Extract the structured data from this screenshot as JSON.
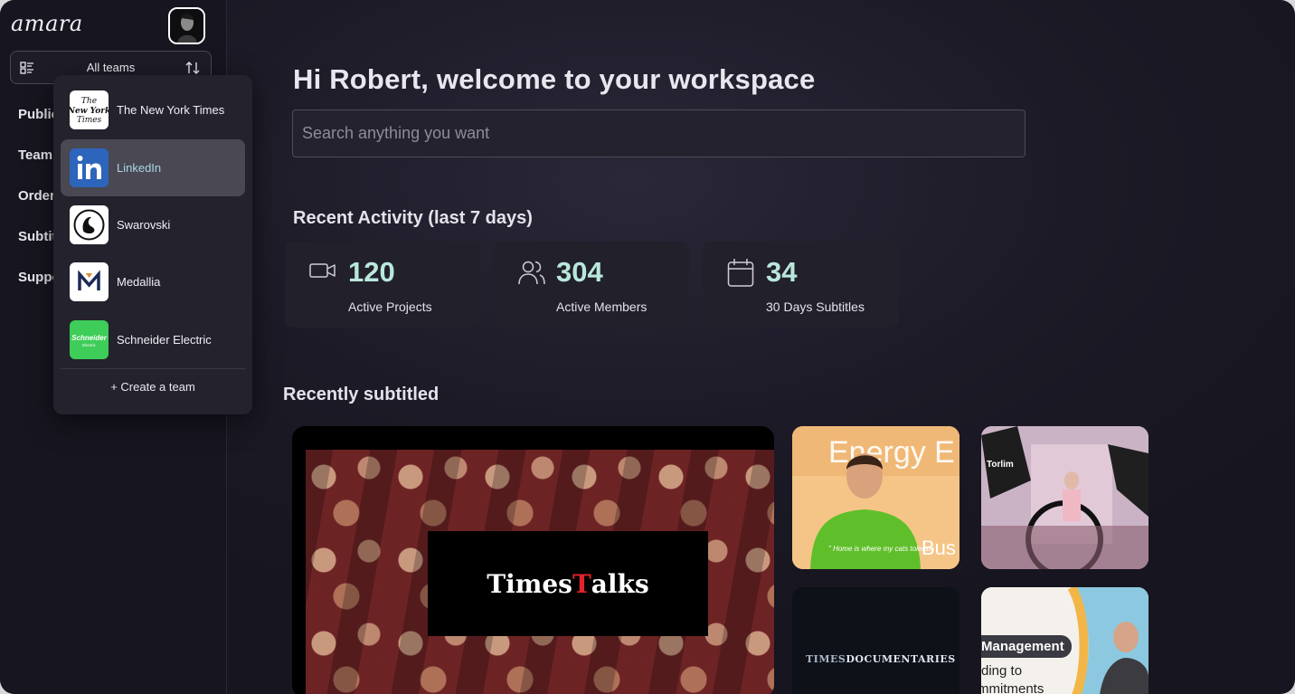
{
  "app": {
    "logo": "amara"
  },
  "team_switcher": {
    "label": "All teams"
  },
  "nav": {
    "items": [
      {
        "label": "Public"
      },
      {
        "label": "Team"
      },
      {
        "label": "Order"
      },
      {
        "label": "Subtit"
      },
      {
        "label": "Suppo"
      }
    ]
  },
  "dropdown": {
    "teams": [
      {
        "name": "The New York Times",
        "logo_text": "The New York Times",
        "logo_bg": "#ffffff",
        "active": false
      },
      {
        "name": "LinkedIn",
        "logo_text": "in",
        "logo_bg": "#2d64bc",
        "active": true
      },
      {
        "name": "Swarovski",
        "logo_text": "swan",
        "logo_bg": "#ffffff",
        "active": false
      },
      {
        "name": "Medallia",
        "logo_text": "M",
        "logo_bg": "#ffffff",
        "active": false
      },
      {
        "name": "Schneider Electric",
        "logo_text": "Schneider Electric",
        "logo_bg": "#3dcd58",
        "active": false
      }
    ],
    "create_label": "+ Create a team"
  },
  "main": {
    "greeting": "Hi Robert, welcome to your workspace",
    "search_placeholder": "Search anything you want",
    "recent_activity_title": "Recent Activity (last 7 days)",
    "stats": [
      {
        "icon": "video-camera-icon",
        "value": "120",
        "label": "Active Projects"
      },
      {
        "icon": "users-icon",
        "value": "304",
        "label": "Active Members"
      },
      {
        "icon": "calendar-icon",
        "value": "34",
        "label": "30 Days Subtitles"
      }
    ],
    "recently_subtitled_title": "Recently subtitled",
    "videos": {
      "times_talks": {
        "prefix": "Times",
        "red_t": "T",
        "suffix": "alks"
      },
      "energy": {
        "headline": "Energy E",
        "side_text": "Bus",
        "shirt_text": "\" Home is where my cats tolerate"
      },
      "studio": {
        "brand": "Torlim"
      },
      "docs": {
        "text_a": "TIMES",
        "text_b": "DOCUMENTARIES"
      },
      "management": {
        "tag": "Management",
        "line1": "ding to",
        "line2": "mmitments"
      }
    }
  },
  "colors": {
    "accent_stat": "#b9e8db",
    "background": "#1c1a26",
    "sidebar": "#17151f"
  }
}
